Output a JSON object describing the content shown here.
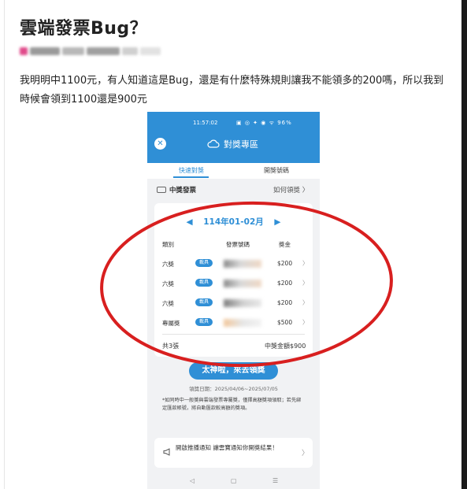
{
  "post": {
    "title": "雲端發票Bug？",
    "body": "我明明中1100元，有人知道這是Bug，還是有什麼特殊規則讓我不能領多的200嗎，所以我到時候會領到1100還是900元"
  },
  "phone": {
    "status": {
      "time": "11:57:02",
      "icons": "▣ ◎ ✦ ◉ ᯤ 96%"
    },
    "header": {
      "close_glyph": "✕",
      "title": "對獎專區"
    },
    "tabs": [
      {
        "label": "快速對獎"
      },
      {
        "label": "開獎號碼"
      }
    ],
    "prize_section": {
      "label": "中獎發票",
      "how_to_claim": "如何領獎 〉"
    },
    "card": {
      "period": "114年01-02月",
      "arrow_left": "◀",
      "arrow_right": "▶",
      "columns": {
        "category": "類別",
        "number": "發票號碼",
        "prize": "獎金"
      },
      "rows": [
        {
          "category": "六獎",
          "badge": "載具",
          "amount": "$200",
          "chevron": "〉"
        },
        {
          "category": "六獎",
          "badge": "載具",
          "amount": "$200",
          "chevron": "〉"
        },
        {
          "category": "六獎",
          "badge": "載具",
          "amount": "$200",
          "chevron": "〉"
        },
        {
          "category": "專屬獎",
          "badge": "載具",
          "amount": "$500",
          "chevron": "〉"
        }
      ],
      "count": "共3張",
      "total": "中獎金額$900"
    },
    "claim_button": "太神啦，來去領獎",
    "claim_date": "領獎日期：2025/04/06~2025/07/05",
    "note": "*如同時中一般獎與雲端發票專屬獎，僅擇高額獎項領取；若先綁定匯款帳號，將自動匯款較高額的獎項。",
    "push": {
      "text": "開啟推播通知 讓雲寶通知你開獎結果！",
      "chevron": "〉"
    },
    "nav": {
      "back": "◁",
      "home": "▢",
      "menu": "☰"
    }
  },
  "colors": {
    "accent": "#2f8fd6",
    "annotation": "#d81f1f"
  },
  "icons": [
    "close-icon",
    "cloud-icon",
    "ticket-icon",
    "megaphone-icon",
    "chevron-right-icon"
  ]
}
